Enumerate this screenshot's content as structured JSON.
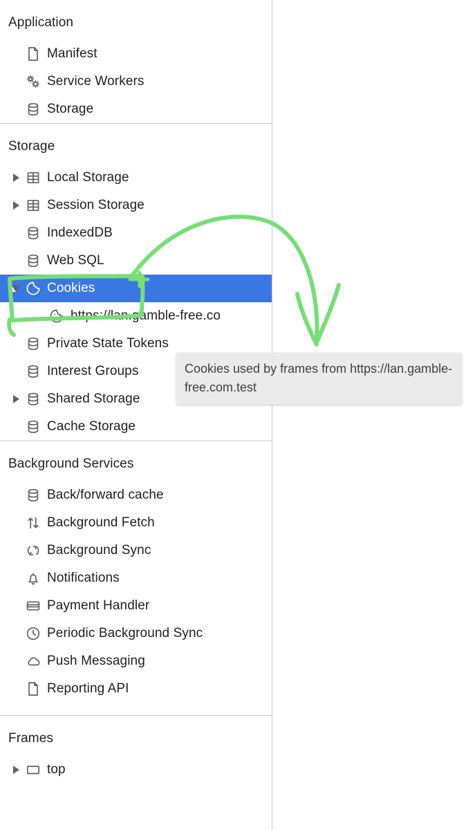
{
  "panel": {
    "name": "Chrome DevTools Application panel"
  },
  "sections": [
    {
      "id": "application",
      "title": "Application",
      "items": [
        {
          "label": "Manifest",
          "icon": "document-icon",
          "twisty": "none"
        },
        {
          "label": "Service Workers",
          "icon": "gears-icon",
          "twisty": "none"
        },
        {
          "label": "Storage",
          "icon": "database-icon",
          "twisty": "none"
        }
      ]
    },
    {
      "id": "storage",
      "title": "Storage",
      "items": [
        {
          "label": "Local Storage",
          "icon": "table-icon",
          "twisty": "collapsed"
        },
        {
          "label": "Session Storage",
          "icon": "table-icon",
          "twisty": "collapsed"
        },
        {
          "label": "IndexedDB",
          "icon": "database-icon",
          "twisty": "none"
        },
        {
          "label": "Web SQL",
          "icon": "database-icon",
          "twisty": "none"
        },
        {
          "label": "Cookies",
          "icon": "cookie-icon",
          "twisty": "expanded",
          "selected": true
        },
        {
          "label": "https://lan.gamble-free.co",
          "icon": "cookie-icon",
          "twisty": "none",
          "child": true
        },
        {
          "label": "Private State Tokens",
          "icon": "database-icon",
          "twisty": "none"
        },
        {
          "label": "Interest Groups",
          "icon": "database-icon",
          "twisty": "none"
        },
        {
          "label": "Shared Storage",
          "icon": "database-icon",
          "twisty": "collapsed"
        },
        {
          "label": "Cache Storage",
          "icon": "database-icon",
          "twisty": "none"
        }
      ]
    },
    {
      "id": "background-services",
      "title": "Background Services",
      "items": [
        {
          "label": "Back/forward cache",
          "icon": "database-icon",
          "twisty": "none"
        },
        {
          "label": "Background Fetch",
          "icon": "updown-arrows-icon",
          "twisty": "none"
        },
        {
          "label": "Background Sync",
          "icon": "sync-icon",
          "twisty": "none"
        },
        {
          "label": "Notifications",
          "icon": "bell-icon",
          "twisty": "none"
        },
        {
          "label": "Payment Handler",
          "icon": "credit-card-icon",
          "twisty": "none"
        },
        {
          "label": "Periodic Background Sync",
          "icon": "clock-icon",
          "twisty": "none"
        },
        {
          "label": "Push Messaging",
          "icon": "cloud-icon",
          "twisty": "none"
        },
        {
          "label": "Reporting API",
          "icon": "document-icon",
          "twisty": "none"
        }
      ]
    },
    {
      "id": "frames",
      "title": "Frames",
      "items": [
        {
          "label": "top",
          "icon": "frame-icon",
          "twisty": "collapsed"
        }
      ]
    }
  ],
  "tooltip": {
    "text": "Cookies used by frames from https://lan.gamble-free.com.test"
  },
  "annotation": {
    "color": "#77dd77",
    "shapes": "highlight-box-around-cookies-row-and-curved-arrow"
  },
  "colors": {
    "selection_blue": "#3b77e3",
    "icon_gray": "#5f6368",
    "text": "#202124",
    "divider": "#cacaca",
    "tooltip_bg": "#ebebeb",
    "annotation_green": "#77dd77"
  }
}
